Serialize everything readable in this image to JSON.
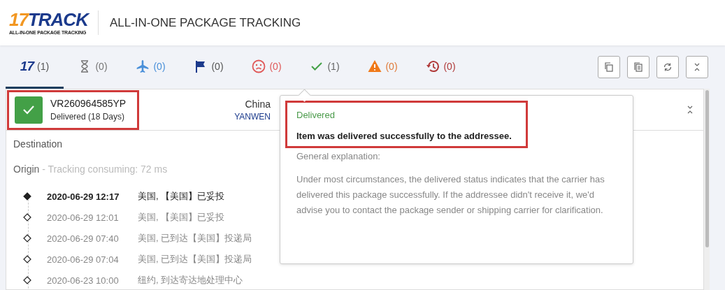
{
  "header": {
    "logo": {
      "mark": "17",
      "word": "TRACK",
      "tagline": "ALL-IN-ONE PACKAGE TRACKING"
    },
    "title": "ALL-IN-ONE PACKAGE TRACKING"
  },
  "tabs": [
    {
      "kind": "all",
      "icon_text": "17",
      "count": "(1)",
      "selected": true
    },
    {
      "kind": "pending",
      "count": "(0)",
      "selected": false
    },
    {
      "kind": "transit",
      "count": "(0)",
      "selected": false
    },
    {
      "kind": "pickup",
      "count": "(0)",
      "selected": false
    },
    {
      "kind": "undelivered",
      "count": "(0)",
      "selected": false
    },
    {
      "kind": "delivered",
      "count": "(1)",
      "selected": false
    },
    {
      "kind": "alert",
      "count": "(0)",
      "selected": false
    },
    {
      "kind": "expired",
      "count": "(0)",
      "selected": false
    }
  ],
  "toolbar": [
    {
      "kind": "copy"
    },
    {
      "kind": "paste"
    },
    {
      "kind": "refresh"
    },
    {
      "kind": "collapse"
    }
  ],
  "package": {
    "number": "VR260964585YP",
    "status": "Delivered (18 Days)",
    "delivered": true,
    "country": "China",
    "carrier": "YANWEN",
    "highlighted": true
  },
  "destination": "Destination",
  "origin": {
    "label": "Origin",
    "note": " - Tracking consuming: 72 ms"
  },
  "events": [
    {
      "time": "2020-06-29 12:17",
      "text": "美国, 【美国】已妥投",
      "current": true
    },
    {
      "time": "2020-06-29 12:01",
      "text": "美国, 【美国】已妥投",
      "current": false
    },
    {
      "time": "2020-06-29 07:40",
      "text": "美国, 已到达【美国】投递局",
      "current": false
    },
    {
      "time": "2020-06-29 07:04",
      "text": "美国, 已到达【美国】投递局",
      "current": false
    },
    {
      "time": "2020-06-23 10:00",
      "text": "纽约, 到达寄达地处理中心",
      "current": false
    }
  ],
  "popover": {
    "status": "Delivered",
    "summary": "Item was delivered successfully to the addressee.",
    "highlighted": true,
    "heading": "General explanation:",
    "explanation": "Under most circumstances, the delivered status indicates that the carrier has delivered this package successfully. If the addressee didn't receive it, we'd advise you to contact the package sender or shipping carrier for clarification."
  }
}
